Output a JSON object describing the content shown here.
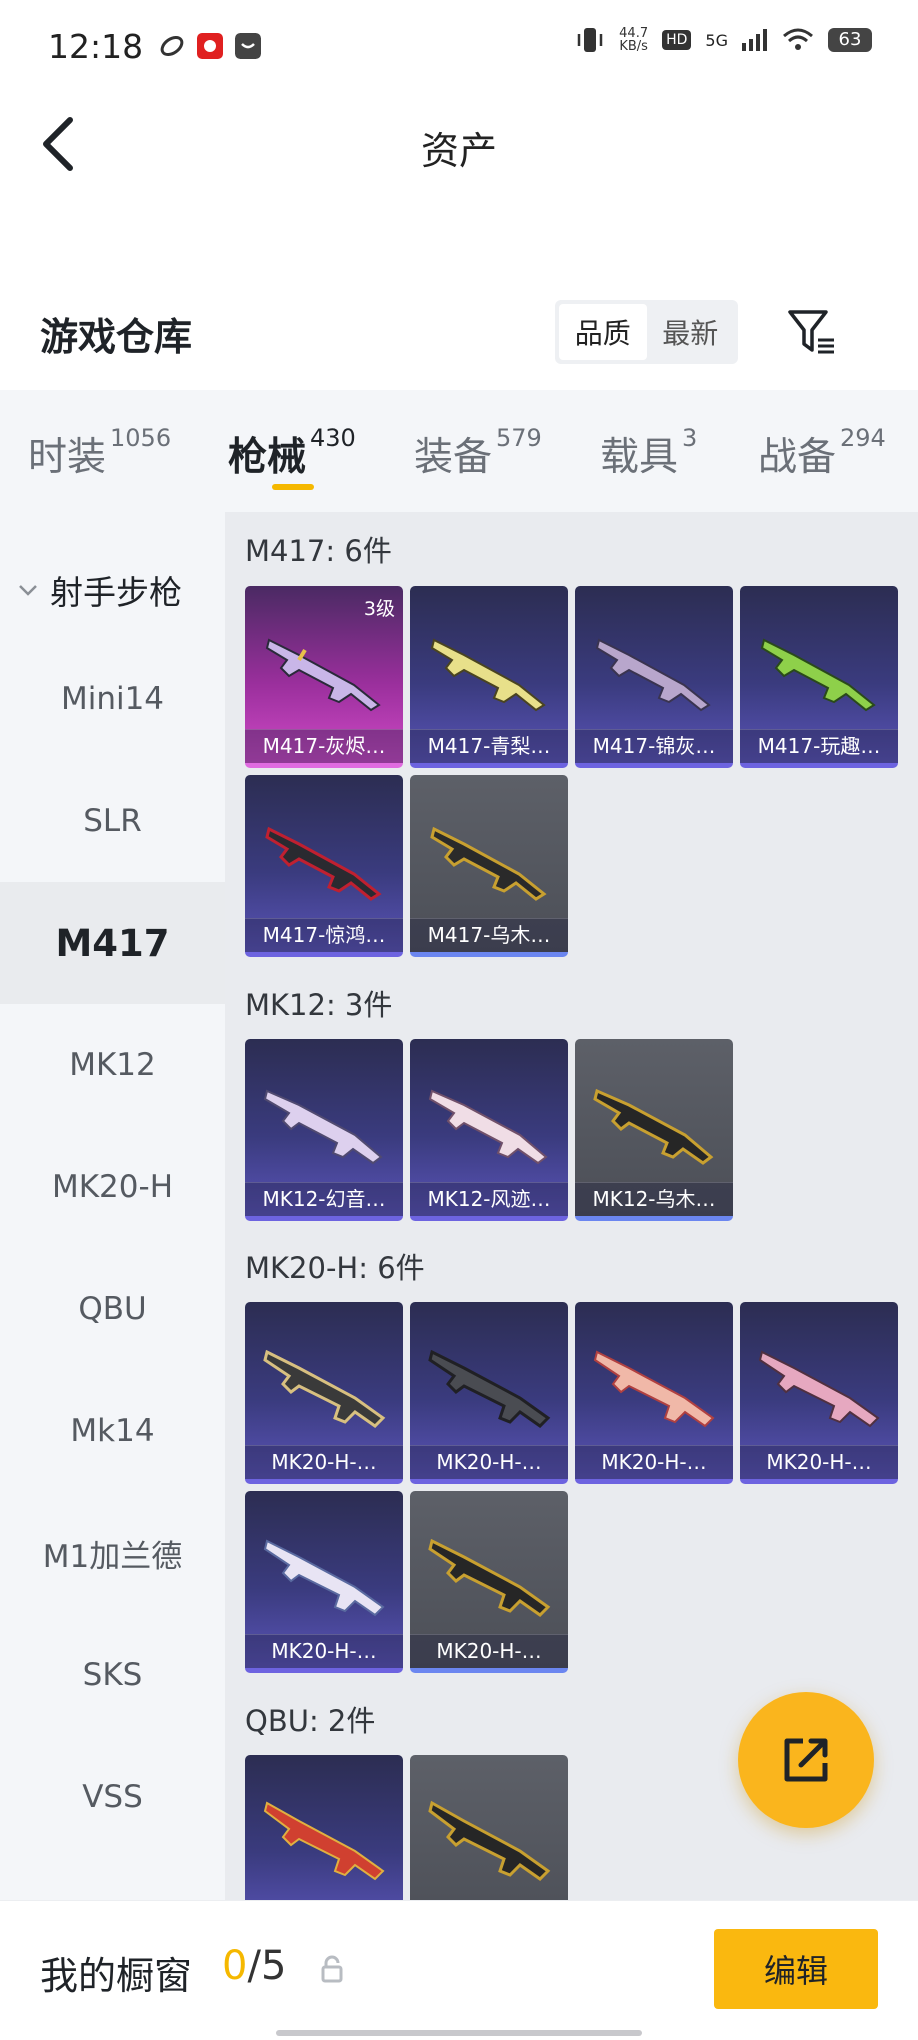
{
  "status_bar": {
    "time": "12:18",
    "net_speed_value": "44.7",
    "net_speed_unit": "KB/s",
    "hd_label": "HD",
    "network_label": "5G",
    "battery": "63"
  },
  "header": {
    "title": "资产"
  },
  "warehouse": {
    "title": "游戏仓库",
    "sort_options": [
      "品质",
      "最新"
    ],
    "sort_selected": "品质"
  },
  "categories": [
    {
      "label": "时装",
      "count": "1056"
    },
    {
      "label": "枪械",
      "count": "430",
      "active": true
    },
    {
      "label": "装备",
      "count": "579"
    },
    {
      "label": "载具",
      "count": "3"
    },
    {
      "label": "战备",
      "count": "294"
    }
  ],
  "sidebar": {
    "group": "射手步枪",
    "items": [
      "Mini14",
      "SLR",
      "M417",
      "MK12",
      "MK20-H",
      "QBU",
      "Mk14",
      "M1加兰德",
      "SKS",
      "VSS"
    ],
    "active": "M417"
  },
  "groups": [
    {
      "title": "M417: 6件",
      "items": [
        {
          "name": "M417-灰烬…",
          "level": "3级"
        },
        {
          "name": "M417-青梨…"
        },
        {
          "name": "M417-锦灰…"
        },
        {
          "name": "M417-玩趣…"
        },
        {
          "name": "M417-惊鸿…"
        },
        {
          "name": "M417-乌木…"
        }
      ]
    },
    {
      "title": "MK12: 3件",
      "items": [
        {
          "name": "MK12-幻音…"
        },
        {
          "name": "MK12-风迹…"
        },
        {
          "name": "MK12-乌木…"
        }
      ]
    },
    {
      "title": "MK20-H: 6件",
      "items": [
        {
          "name": "MK20-H-…"
        },
        {
          "name": "MK20-H-…"
        },
        {
          "name": "MK20-H-…"
        },
        {
          "name": "MK20-H-…"
        },
        {
          "name": "MK20-H-…"
        },
        {
          "name": "MK20-H-…"
        }
      ]
    },
    {
      "title": "QBU: 2件",
      "items": [
        {
          "name": ""
        },
        {
          "name": ""
        }
      ]
    }
  ],
  "showcase": {
    "label": "我的橱窗",
    "used": "0",
    "separator": "/",
    "total": "5",
    "edit_label": "编辑"
  },
  "colors": {
    "accent": "#f5b800",
    "fab": "#fab51d",
    "card_purple": "#3a3b7e",
    "card_grey": "#4c4f57",
    "card_pink": "#c040c0"
  }
}
